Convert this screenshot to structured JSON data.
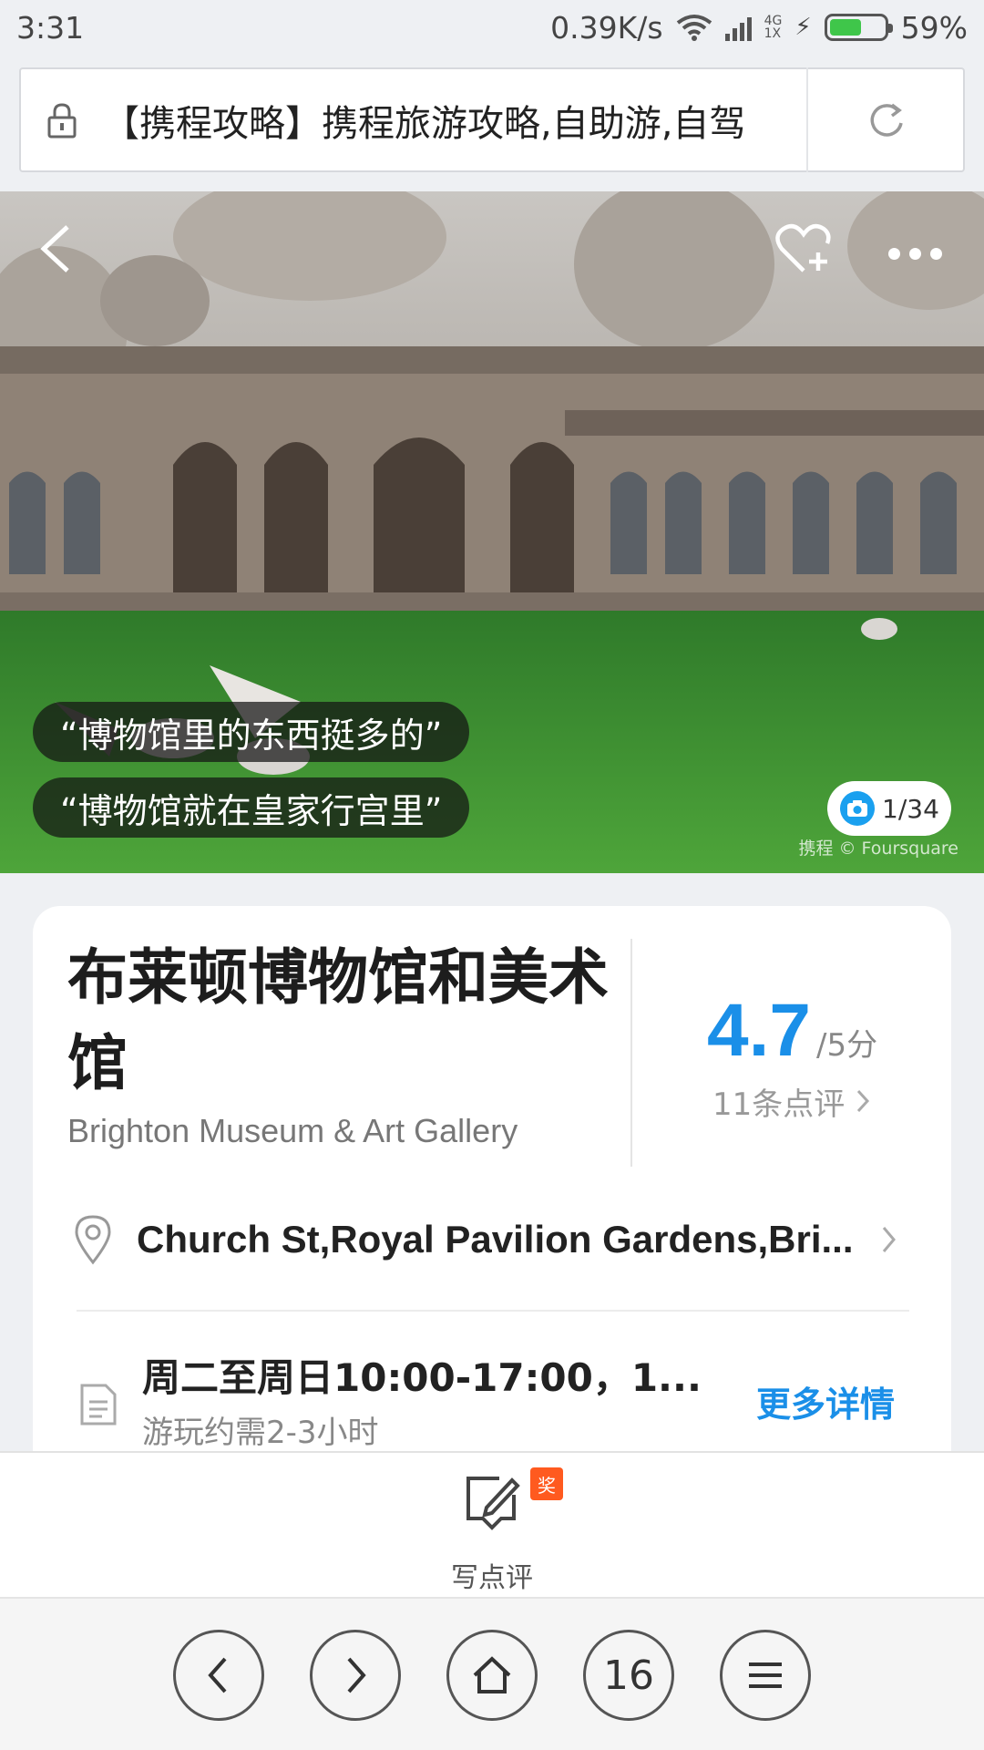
{
  "status_bar": {
    "time": "3:31",
    "speed": "0.39K/s",
    "network_type_top": "4G",
    "network_type_bottom": "1X",
    "battery": "59%",
    "battery_level": 0.59
  },
  "address_bar": {
    "title": "【携程攻略】携程旅游攻略,自助游,自驾",
    "reload_icon": "reload-icon",
    "lock_icon": "lock-icon"
  },
  "hero": {
    "quotes": [
      "“博物馆里的东西挺多的”",
      "“博物馆就在皇家行宫里”"
    ],
    "photo_counter": "1/34",
    "watermark": "携程 © Foursquare",
    "icons": [
      "back-arrow-icon",
      "favorite-add-icon",
      "more-dots-icon",
      "camera-icon"
    ]
  },
  "poi": {
    "title": "布莱顿博物馆和美术馆",
    "subtitle": "Brighton Museum & Art Gallery",
    "rating": "4.7",
    "rating_max": "/5分",
    "reviews_link": "11条点评",
    "address": "Church St,Royal Pavilion Gardens,Bri...",
    "hours": "周二至周日10:00-17:00，1...",
    "duration": "游玩约需2-3小时",
    "more_details": "更多详情"
  },
  "review_bar": {
    "label": "写点评",
    "badge": "奖"
  },
  "browser_nav": {
    "back": "‹",
    "forward": "›",
    "tabs_count": "16"
  },
  "colors": {
    "accent": "#1a8fe8",
    "badge": "#ff5a1f",
    "battery": "#3fc64a"
  }
}
